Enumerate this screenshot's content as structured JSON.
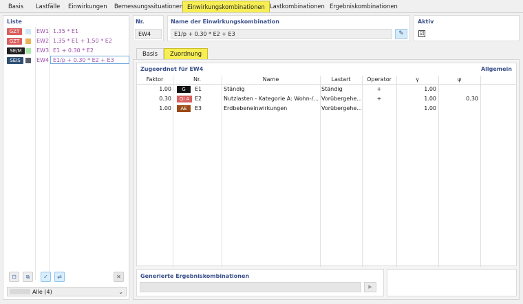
{
  "top_tabs": [
    {
      "label": "Basis",
      "active": false
    },
    {
      "label": "Lastfälle",
      "active": false
    },
    {
      "label": "Einwirkungen",
      "active": false
    },
    {
      "label": "Bemessungssituationen",
      "active": false
    },
    {
      "label": "Einwirkungskombinationen",
      "active": true
    },
    {
      "label": "Lastkombinationen",
      "active": false
    },
    {
      "label": "Ergebniskombinationen",
      "active": false
    }
  ],
  "list": {
    "title": "Liste",
    "items": [
      {
        "badge": "GZT",
        "badge_color": "#d9605f",
        "swatch_color": "#cfe9f6",
        "code": "EW1",
        "expr": "1.35 * E1",
        "expr_color": "#9b4fa8",
        "selected": false
      },
      {
        "badge": "GZT",
        "badge_color": "#d9605f",
        "swatch_color": "#e9b35a",
        "code": "EW2",
        "expr": "1.35 * E1 + 1.50 * E2",
        "expr_color": "#9b4fa8",
        "selected": false
      },
      {
        "badge": "SE/M",
        "badge_color": "#1f1f1f",
        "swatch_color": "#a9e7a9",
        "code": "EW3",
        "expr": "E1 + 0.30 * E2",
        "expr_color": "#9b4fa8",
        "selected": false
      },
      {
        "badge": "SEIS",
        "badge_color": "#2d4f73",
        "swatch_color": "#555b66",
        "code": "EW4",
        "expr": "E1/p + 0.30 * E2 + E3",
        "expr_color": "#9b4fa8",
        "selected": true
      }
    ],
    "filter_label": "Alle (4)"
  },
  "header": {
    "nr_label": "Nr.",
    "nr_value": "EW4",
    "name_label": "Name der Einwirkungskombination",
    "name_value": "E1/p + 0.30 * E2 + E3",
    "aktiv_label": "Aktiv",
    "aktiv_checked": "☑"
  },
  "inner_tabs": [
    {
      "label": "Basis",
      "active": false
    },
    {
      "label": "Zuordnung",
      "active": true
    }
  ],
  "assigned": {
    "title": "Zugeordnet für EW4",
    "link": "Allgemein",
    "columns": [
      "Faktor",
      "Nr.",
      "Name",
      "Lastart",
      "Operator",
      "γ",
      "ψ"
    ],
    "rows": [
      {
        "factor": "1.00",
        "badge": "G",
        "badge_color": "#111111",
        "nr": "E1",
        "name": "Ständig",
        "lastart": "Ständig",
        "operator": "+",
        "gamma": "1.00",
        "psi": ""
      },
      {
        "factor": "0.30",
        "badge": "QI A",
        "badge_color": "#d9605f",
        "nr": "E2",
        "name": "Nutzlasten - Kategorie A: Wohn-/...",
        "lastart": "Vorübergehe...",
        "operator": "+",
        "gamma": "1.00",
        "psi": "0.30"
      },
      {
        "factor": "1.00",
        "badge": "AE",
        "badge_color": "#9a4a16",
        "nr": "E3",
        "name": "Erdbebeneinwirkungen",
        "lastart": "Vorübergehe...",
        "operator": "",
        "gamma": "1.00",
        "psi": ""
      }
    ]
  },
  "generated": {
    "title": "Generierte Ergebniskombinationen"
  },
  "icons": [
    "new-item-icon",
    "copy-item-icon",
    "check-all-icon",
    "check-toggle-icon",
    "delete-icon",
    "edit-icon",
    "play-icon",
    "chevron-down-icon"
  ]
}
